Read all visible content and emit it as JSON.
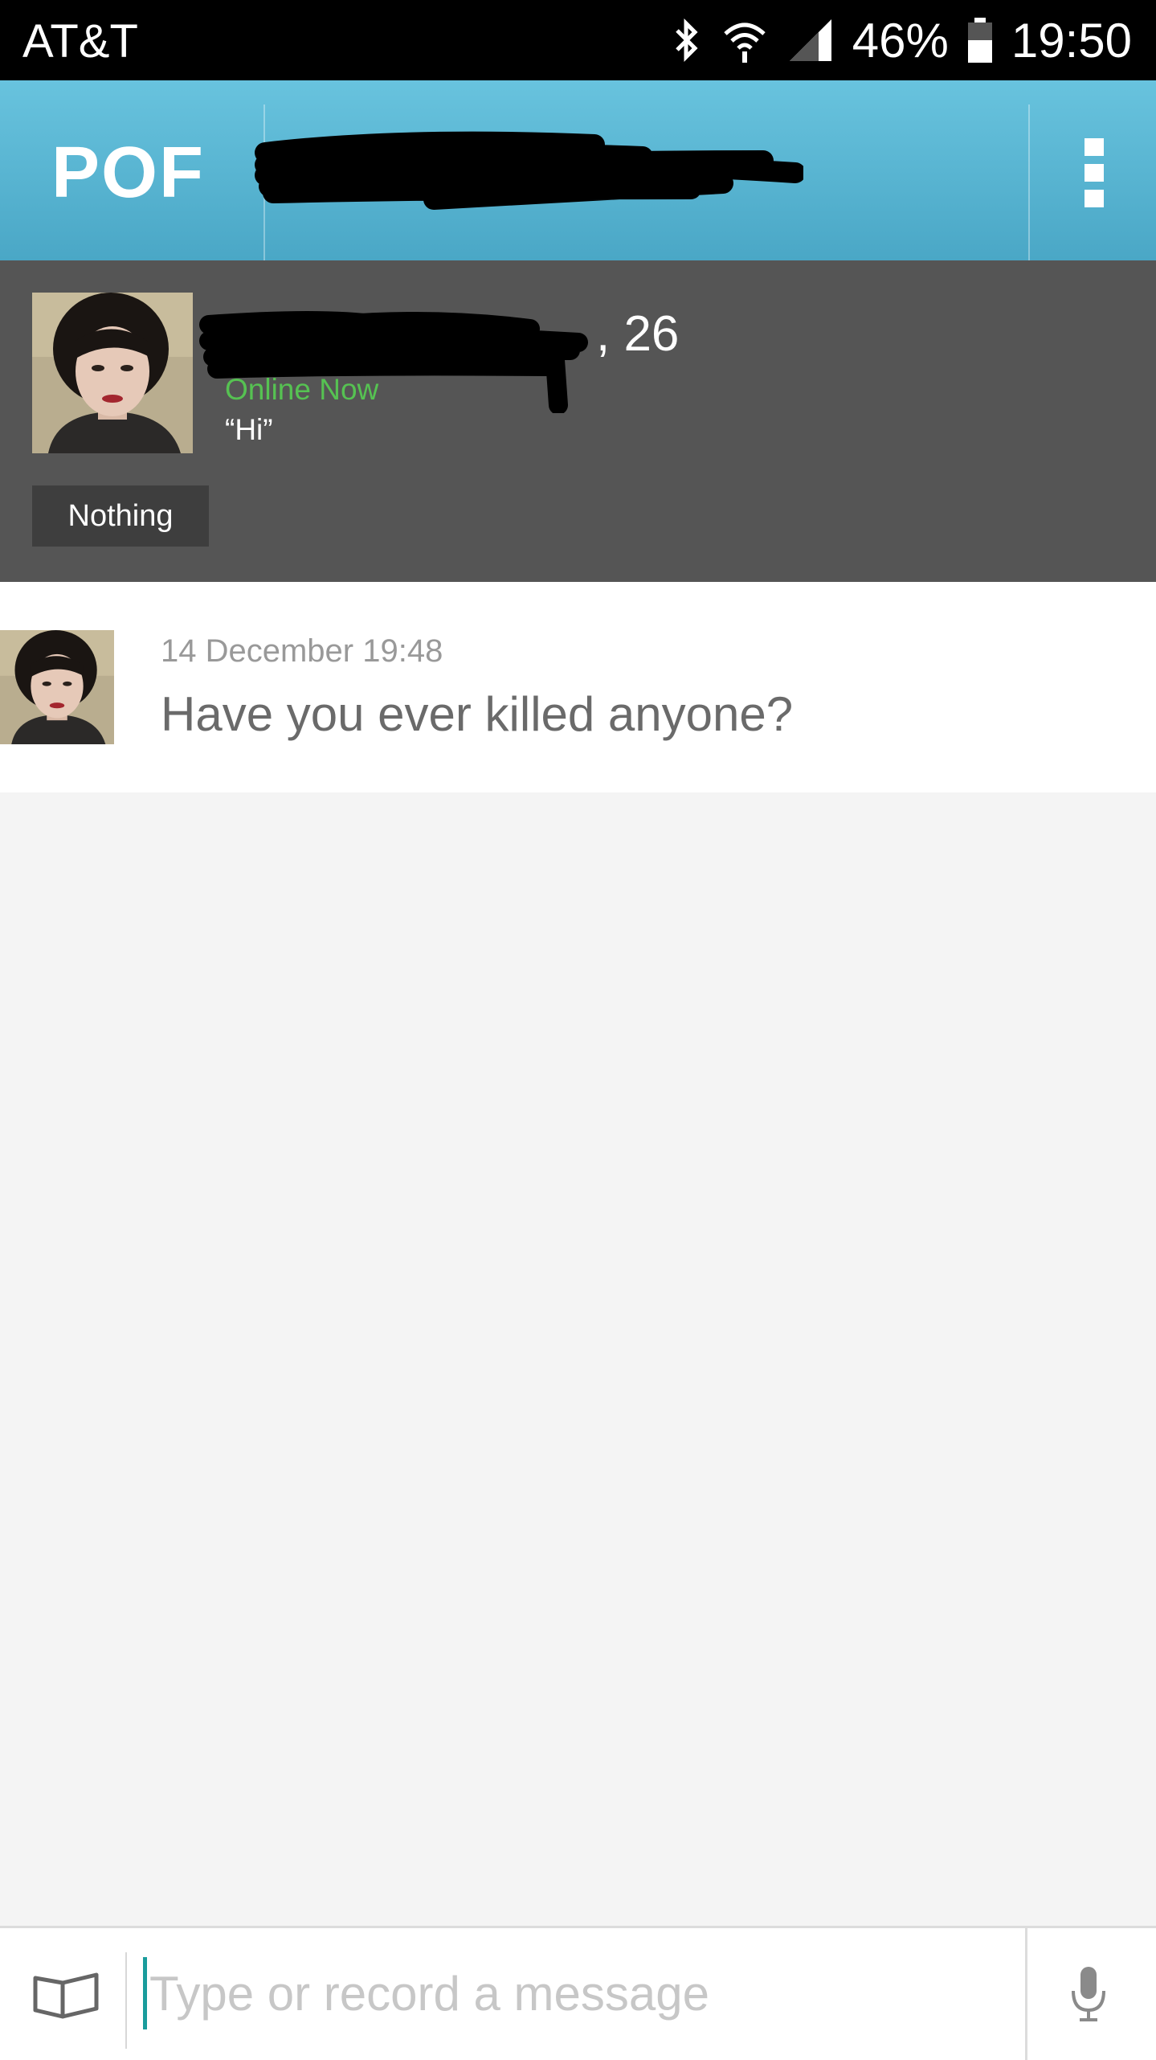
{
  "status_bar": {
    "carrier": "AT&T",
    "battery": "46%",
    "time": "19:50",
    "icons": [
      "bluetooth-icon",
      "wifi-icon",
      "signal-icon",
      "battery-icon"
    ]
  },
  "app_bar": {
    "logo": "POF",
    "menu_icon": "overflow-menu-icon"
  },
  "profile": {
    "age_suffix": ", 26",
    "status": "Online Now",
    "headline": "“Hi”",
    "tag": "Nothing"
  },
  "message": {
    "timestamp": "14 December 19:48",
    "text": "Have you ever killed anyone?"
  },
  "composer": {
    "placeholder": "Type or record a message",
    "left_icon": "sticker-icon",
    "right_icon": "microphone-icon"
  },
  "colors": {
    "app_bar": "#5ab5d3",
    "profile_bg": "#555555",
    "online": "#56c252",
    "cursor": "#1a9c9c"
  }
}
